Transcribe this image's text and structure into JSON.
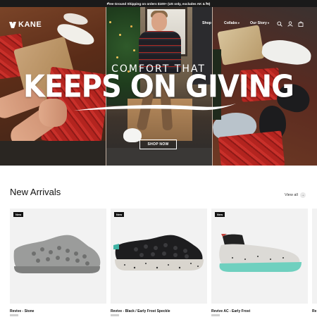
{
  "announcement": {
    "text": "Free Ground Shipping on orders $100+ (US only, excludes AK & HI)",
    "prev_icon": "chevron-left-icon",
    "next_icon": "chevron-right-icon"
  },
  "header": {
    "logo_text": "KANE",
    "nav": [
      {
        "label": "Shop"
      },
      {
        "label": "Collabs"
      },
      {
        "label": "Our Story"
      }
    ],
    "icons": [
      "search-icon",
      "account-icon",
      "cart-icon"
    ]
  },
  "hero": {
    "subtitle": "COMFORT THAT",
    "title": "KEEPS ON GIVING",
    "cta": "SHOP NOW",
    "colors": {
      "overlay_text": "#ffffff"
    }
  },
  "new_arrivals": {
    "title": "New Arrivals",
    "view_all": "View all",
    "products": [
      {
        "badge": "New",
        "name": "Revive - Stone"
      },
      {
        "badge": "New",
        "name": "Revive - Black / Early Frost Speckle"
      },
      {
        "badge": "New",
        "name": "Revive AC - Early Frost"
      }
    ],
    "partial_next_name": "Re"
  }
}
